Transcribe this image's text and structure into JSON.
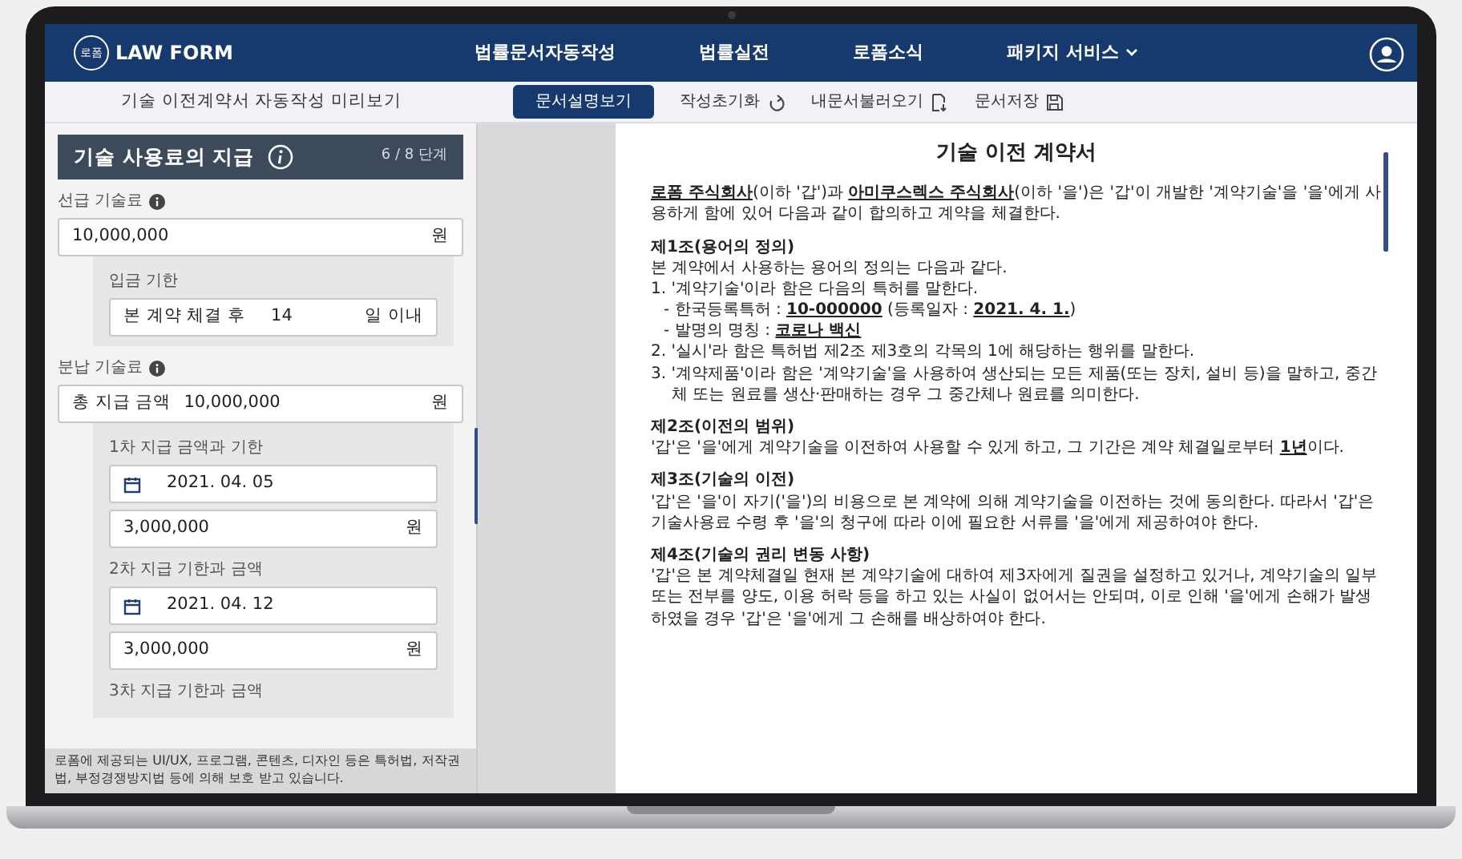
{
  "navbar": {
    "logo_mark": "로폼",
    "brand": "LAW FORM",
    "menu": [
      {
        "label": "법률문서자동작성",
        "dropdown": false
      },
      {
        "label": "법률실전",
        "dropdown": false
      },
      {
        "label": "로폼소식",
        "dropdown": false
      },
      {
        "label": "패키지 서비스",
        "dropdown": true
      }
    ]
  },
  "toolbar": {
    "title": "기술 이전계약서 자동작성 미리보기",
    "primary_button": "문서설명보기",
    "actions": [
      {
        "label": "작성초기화",
        "kind": "reset"
      },
      {
        "label": "내문서불러오기",
        "kind": "load"
      },
      {
        "label": "문서저장",
        "kind": "save"
      }
    ]
  },
  "form": {
    "header": {
      "title": "기술 사용료의 지급",
      "step": "6 / 8 단계"
    },
    "sections": [
      {
        "label": "선급 기술료",
        "info": true,
        "field": {
          "kind": "amount",
          "value": "10,000,000",
          "unit": "원"
        },
        "groups": [
          {
            "label": "입금 기한",
            "fields": [
              {
                "kind": "days",
                "prefix": "본 계약 체결 후",
                "value": "14",
                "unit": "일 이내"
              }
            ]
          }
        ]
      },
      {
        "label": "분납 기술료",
        "info": true,
        "field": {
          "kind": "amount",
          "prefix": "총 지급 금액",
          "value": "10,000,000",
          "unit": "원"
        },
        "groups": [
          {
            "label": "1차 지급 금액과 기한",
            "fields": [
              {
                "kind": "date",
                "value": "2021. 04. 05"
              },
              {
                "kind": "amount",
                "value": "3,000,000",
                "unit": "원"
              }
            ]
          },
          {
            "label": "2차 지급 기한과 금액",
            "fields": [
              {
                "kind": "date",
                "value": "2021. 04. 12"
              },
              {
                "kind": "amount",
                "value": "3,000,000",
                "unit": "원"
              }
            ]
          },
          {
            "label": "3차 지급 기한과 금액"
          }
        ]
      }
    ],
    "notice": "로폼에 제공되는 UI/UX, 프로그램, 콘텐츠, 디자인 등은 특허법, 저작권법, 부정경쟁방지법 등에 의해 보호 받고 있습니다."
  },
  "document": {
    "title": "기술 이전 계약서",
    "blocks": [
      {
        "kind": "para",
        "text": "**로폼 주식회사**(이하 '갑')과 **아미쿠스렉스 주식회사**(이하 '을')은 '갑'이 개발한 '계약기술'을 '을'에게 사용하게 함에 있어 다음과 같이 합의하고 계약을 체결한다."
      },
      {
        "kind": "heading",
        "text": "제1조(용어의 정의)"
      },
      {
        "kind": "line",
        "text": "본 계약에서 사용하는 용어의 정의는 다음과 같다."
      },
      {
        "kind": "item",
        "text": "1. '계약기술'이라 함은 다음의 특허를 말한다."
      },
      {
        "kind": "subitem",
        "text": "- 한국등록특허 : **10-000000** (등록일자 : **2021. 4. 1.**)"
      },
      {
        "kind": "subitem",
        "text": "- 발명의 명칭 : **코로나 백신**"
      },
      {
        "kind": "item",
        "text": "2. '실시'라 함은 특허법 제2조 제3호의 각목의 1에 해당하는 행위를 말한다."
      },
      {
        "kind": "item",
        "text": "3. '계약제품'이라 함은 '계약기술'을 사용하여 생산되는 모든 제품(또는 장치, 설비 등)을 말하고, 중간체 또는 원료를 생산·판매하는 경우 그 중간체나 원료를 의미한다."
      },
      {
        "kind": "heading",
        "text": "제2조(이전의 범위)"
      },
      {
        "kind": "line",
        "text": "'갑'은 '을'에게 계약기술을 이전하여 사용할 수 있게 하고, 그 기간은 계약 체결일로부터 **1년**이다."
      },
      {
        "kind": "heading",
        "text": "제3조(기술의 이전)"
      },
      {
        "kind": "line",
        "text": "'갑'은 '을'이 자기('을')의 비용으로 본 계약에 의해 계약기술을 이전하는 것에 동의한다. 따라서 '갑'은 기술사용료 수령 후 '을'의 청구에 따라 이에 필요한 서류를 '을'에게 제공하여야 한다."
      },
      {
        "kind": "heading",
        "text": "제4조(기술의 권리 변동 사항)"
      },
      {
        "kind": "line",
        "text": "'갑'은 본 계약체결일 현재 본 계약기술에 대하여 제3자에게 질권을 설정하고 있거나, 계약기술의 일부 또는 전부를 양도, 이용 허락 등을 하고 있는 사실이 없어서는 안되며, 이로 인해 '을'에게 손해가 발생하였을 경우 '갑'은 '을'에게 그 손해를 배상하여야 한다."
      }
    ]
  }
}
